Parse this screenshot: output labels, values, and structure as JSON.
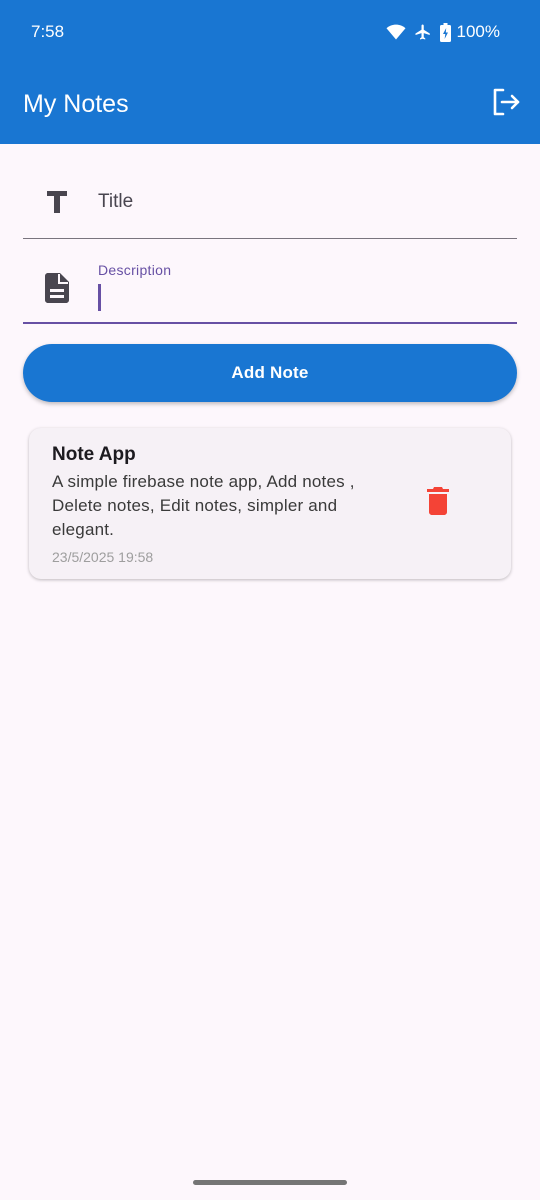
{
  "status_bar": {
    "time": "7:58",
    "battery": "100%",
    "icons": [
      "wifi-icon",
      "airplane-icon",
      "battery-charging-icon"
    ]
  },
  "app_bar": {
    "title": "My Notes",
    "logout_icon": "logout-icon"
  },
  "form": {
    "title_field": {
      "placeholder": "Title",
      "value": "",
      "icon": "title-icon"
    },
    "description_field": {
      "label": "Description",
      "value": "",
      "icon": "document-icon"
    },
    "add_button_label": "Add Note"
  },
  "notes": [
    {
      "title": "Note App",
      "description": "A simple firebase note app, Add notes , Delete notes, Edit notes, simpler and elegant.",
      "date": "23/5/2025 19:58",
      "delete_icon": "trash-icon"
    }
  ],
  "colors": {
    "primary": "#1976d2",
    "accent": "#6750a4",
    "delete": "#f44336",
    "background": "#fdf7fc"
  }
}
